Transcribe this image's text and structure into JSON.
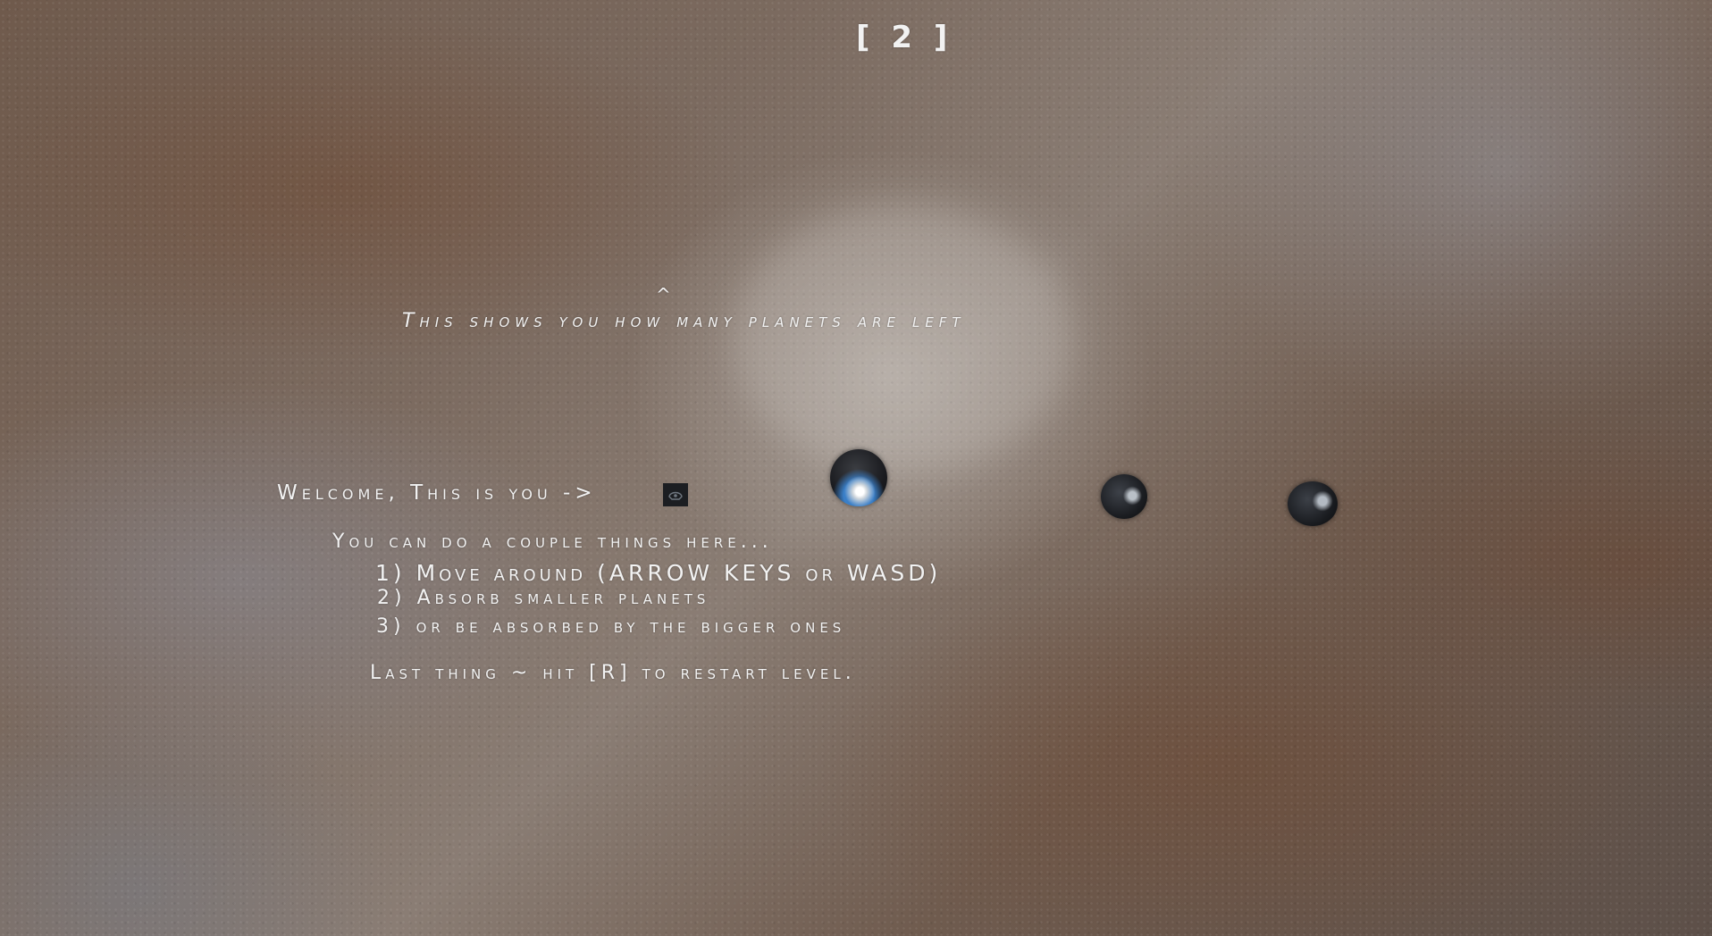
{
  "hud": {
    "planets_left_label": "[ 2 ]"
  },
  "tutorial": {
    "caret": "^",
    "hint": "This shows you how many planets are left",
    "welcome": "Welcome, This is you ->",
    "intro": "You can do a couple things here...",
    "step1": "1) Move around (ARROW KEYS or WASD)",
    "step2": "2) Absorb smaller planets",
    "step3": "3) or be absorbed by the bigger ones",
    "last": "Last thing ~ hit [R] to restart level."
  },
  "entities": {
    "player_icon": "ship-icon",
    "planets": [
      {
        "name": "large-planet",
        "color": "#3a7fc8"
      },
      {
        "name": "medium-planet",
        "color": "#1b1d21"
      },
      {
        "name": "small-planet",
        "color": "#1a1c20"
      }
    ]
  }
}
